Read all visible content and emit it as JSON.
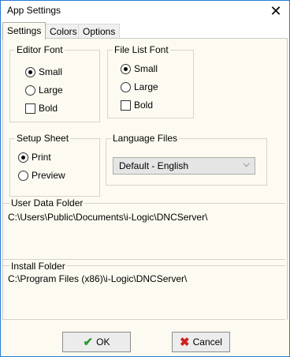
{
  "window": {
    "title": "App Settings",
    "close_glyph": "✕"
  },
  "tabs": [
    {
      "label": "Settings",
      "active": true
    },
    {
      "label": "Colors",
      "active": false
    },
    {
      "label": "Options",
      "active": false
    }
  ],
  "editor_font": {
    "legend": "Editor Font",
    "small_label": "Small",
    "small_selected": true,
    "large_label": "Large",
    "large_selected": false,
    "bold_label": "Bold",
    "bold_checked": false
  },
  "file_list_font": {
    "legend": "File List Font",
    "small_label": "Small",
    "small_selected": true,
    "large_label": "Large",
    "large_selected": false,
    "bold_label": "Bold",
    "bold_checked": false
  },
  "setup_sheet": {
    "legend": "Setup Sheet",
    "print_label": "Print",
    "print_selected": true,
    "preview_label": "Preview",
    "preview_selected": false
  },
  "language_files": {
    "legend": "Language Files",
    "selected_value": "Default - English",
    "chevron_glyph": "⌵"
  },
  "user_data_folder": {
    "label": "User Data Folder",
    "value": "C:\\Users\\Public\\Documents\\i-Logic\\DNCServer\\"
  },
  "install_folder": {
    "label": "Install Folder",
    "value": "C:\\Program Files (x86)\\i-Logic\\DNCServer\\"
  },
  "buttons": {
    "ok_label": "OK",
    "ok_icon": "✔",
    "cancel_label": "Cancel",
    "cancel_icon": "✖"
  },
  "colors": {
    "panel_bg": "#fdfbf1",
    "accent_border": "#2b79d6"
  }
}
